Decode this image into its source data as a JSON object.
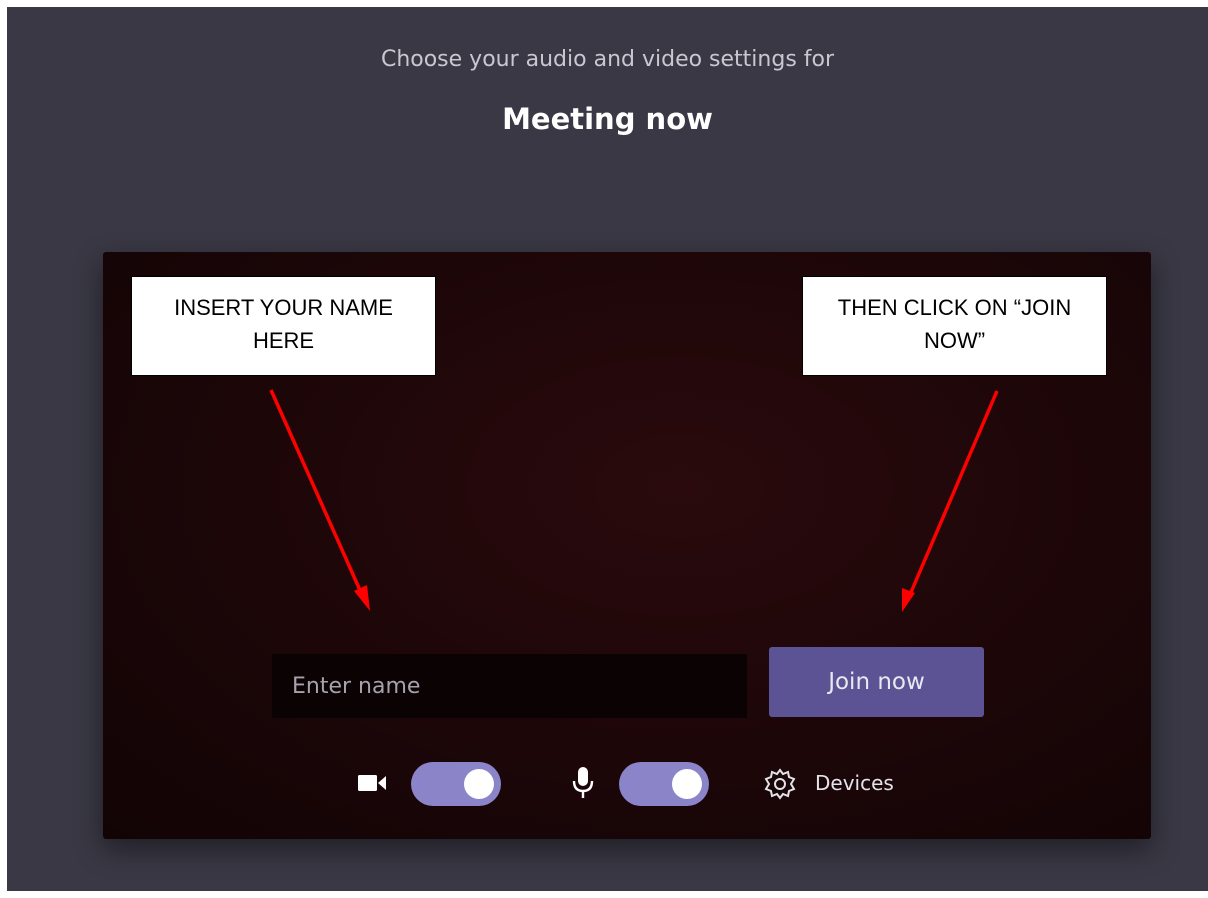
{
  "header": {
    "subtitle": "Choose your audio and video settings for",
    "meeting_title": "Meeting now"
  },
  "annotations": {
    "name_callout": [
      "INSERT YOUR NAME",
      "HERE"
    ],
    "join_callout": [
      "THEN CLICK ON “JOIN",
      "NOW”"
    ],
    "arrow_color": "#ff0000"
  },
  "form": {
    "name_placeholder": "Enter name",
    "name_value": "",
    "join_label": "Join now"
  },
  "controls": {
    "camera": {
      "icon": "video-camera-icon",
      "enabled": true
    },
    "microphone": {
      "icon": "microphone-icon",
      "enabled": true
    },
    "devices": {
      "icon": "gear-icon",
      "label": "Devices"
    },
    "toggle_color": "#8c84c9"
  },
  "colors": {
    "background": "#393844",
    "accent": "#5b5394"
  }
}
